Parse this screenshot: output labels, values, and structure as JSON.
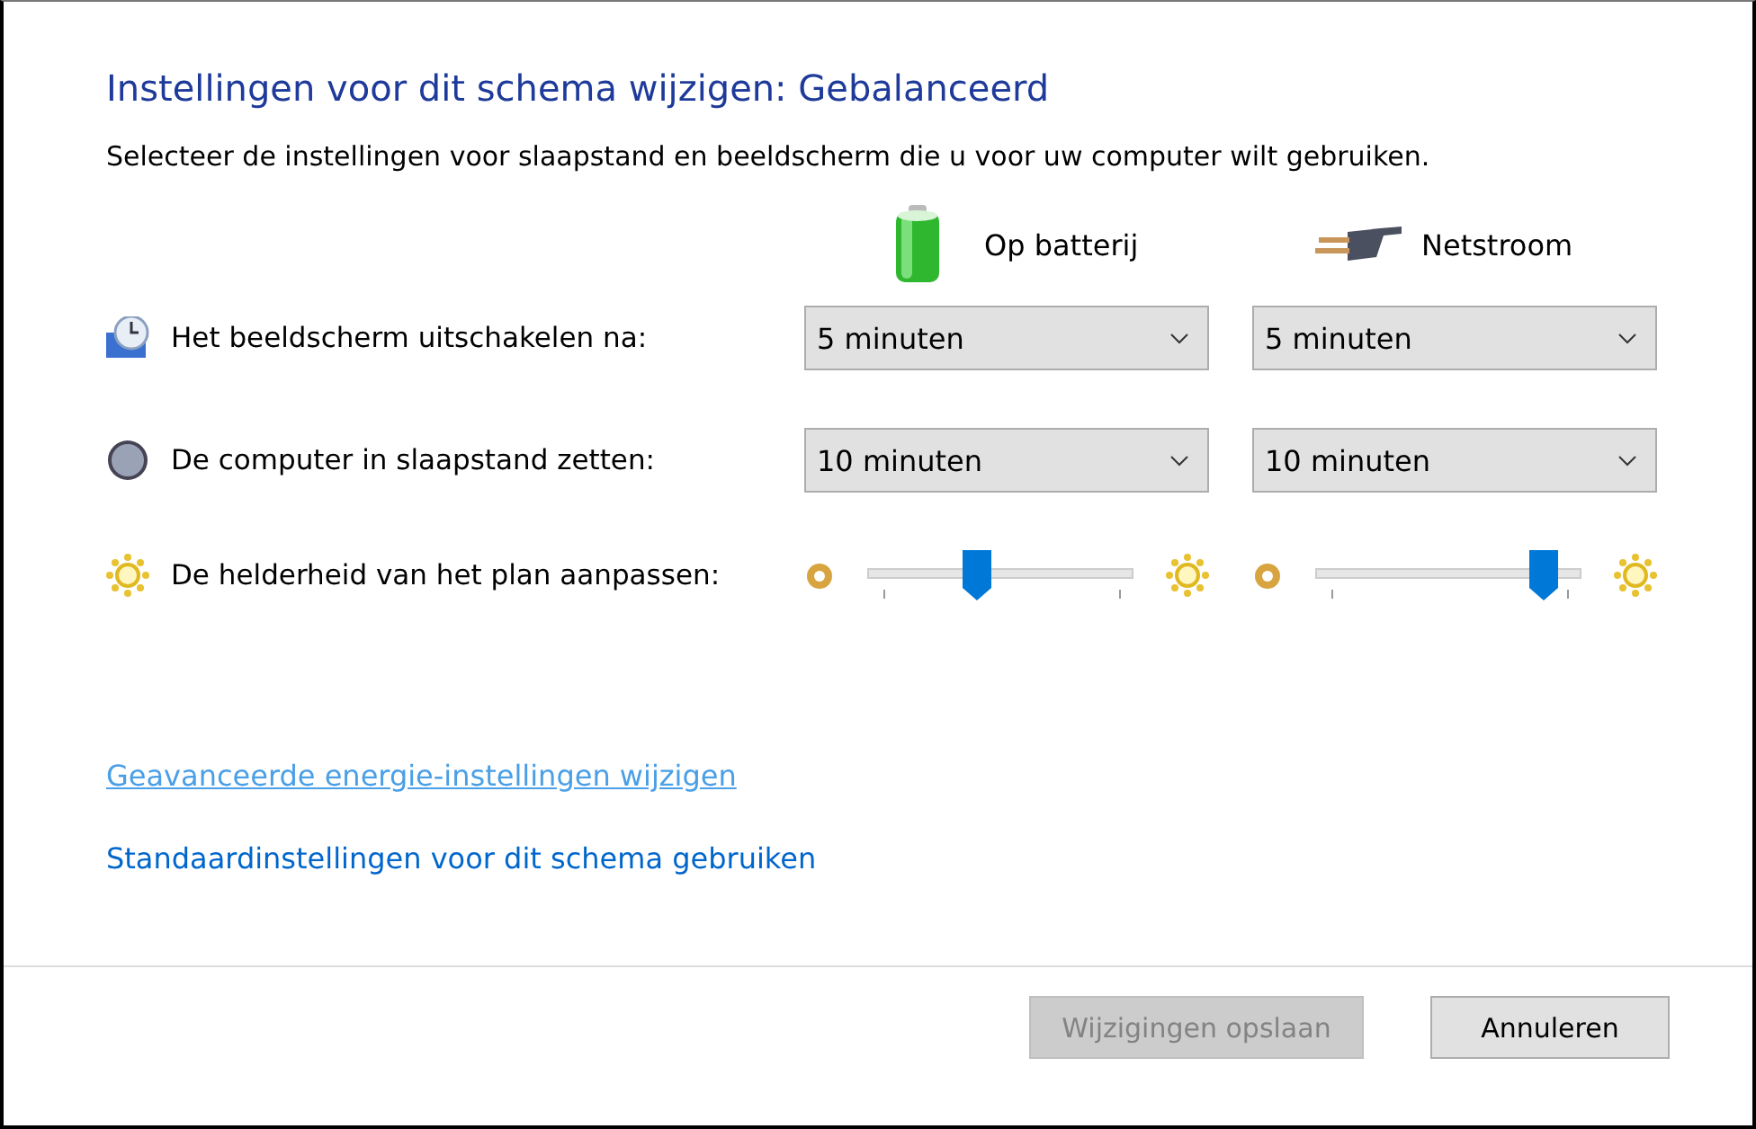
{
  "title": "Instellingen voor dit schema wijzigen: Gebalanceerd",
  "description": "Selecteer de instellingen voor slaapstand en beeldscherm die u voor uw computer wilt gebruiken.",
  "columns": [
    {
      "kind": "battery",
      "label": "Op batterij"
    },
    {
      "kind": "plug",
      "label": "Netstroom"
    }
  ],
  "settings": [
    {
      "kind": "dropdown",
      "label": "Het beeldscherm uitschakelen na:",
      "values": [
        "5 minuten",
        "5 minuten"
      ]
    },
    {
      "kind": "dropdown",
      "label": "De computer in slaapstand zetten:",
      "values": [
        "10 minuten",
        "10 minuten"
      ]
    },
    {
      "kind": "slider",
      "label": "De helderheid van het plan aanpassen:",
      "sliders": [
        {
          "level": 0.41
        },
        {
          "level": 0.86
        }
      ]
    }
  ],
  "links": [
    {
      "label": "Geavanceerde energie-instellingen wijzigen",
      "hovered": true
    },
    {
      "label": "Standaardinstellingen voor dit schema gebruiken",
      "hovered": false
    }
  ],
  "buttons": [
    {
      "label": "Wijzigingen opslaan",
      "disabled": true
    },
    {
      "label": "Annuleren",
      "disabled": false
    }
  ]
}
